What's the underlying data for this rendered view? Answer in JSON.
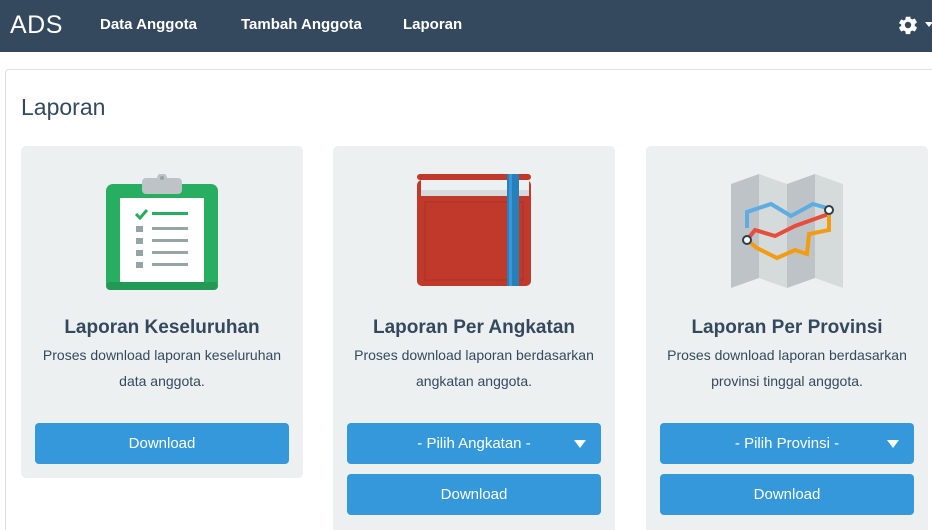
{
  "navbar": {
    "brand": "ADS",
    "links": [
      "Data Anggota",
      "Tambah Anggota",
      "Laporan"
    ],
    "settings_icon": "gear-icon",
    "dropdown_icon": "caret-down-icon",
    "background": "#34495e"
  },
  "page": {
    "title": "Laporan"
  },
  "cards": [
    {
      "icon": "clipboard-icon",
      "title": "Laporan Keseluruhan",
      "description": "Proses download laporan keseluruhan data anggota.",
      "download_label": "Download"
    },
    {
      "icon": "book-icon",
      "title": "Laporan Per Angkatan",
      "description": "Proses download laporan berdasarkan angkatan anggota.",
      "select_label": "- Pilih Angkatan -",
      "download_label": "Download"
    },
    {
      "icon": "map-icon",
      "title": "Laporan Per Provinsi",
      "description": "Proses download laporan berdasarkan provinsi tinggal anggota.",
      "select_label": "- Pilih Provinsi -",
      "download_label": "Download"
    }
  ],
  "colors": {
    "accent": "#3498db",
    "text": "#34495e",
    "card_bg": "#ecf0f1"
  }
}
